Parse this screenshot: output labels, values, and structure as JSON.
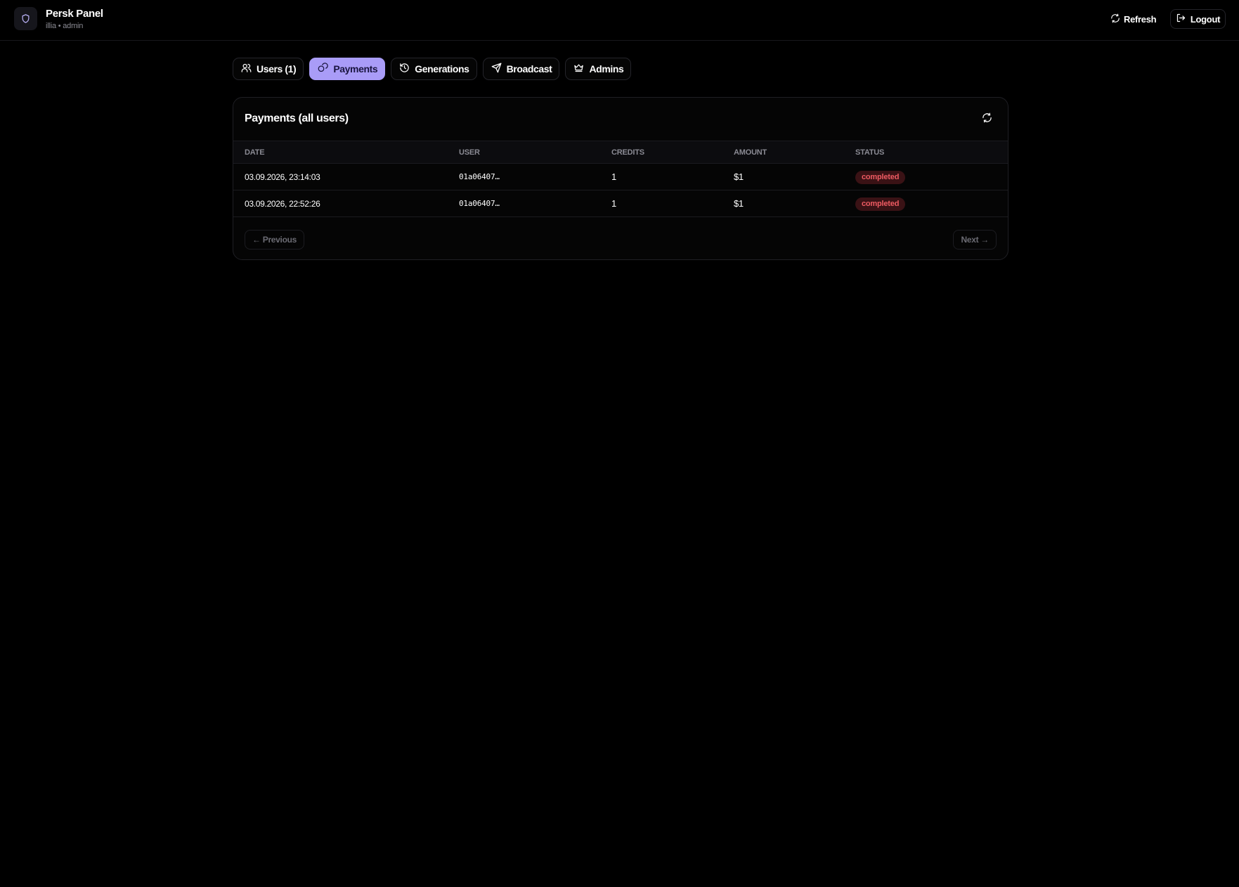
{
  "header": {
    "title": "Persk Panel",
    "subtitle": "illia • admin",
    "refresh_label": "Refresh",
    "logout_label": "Logout"
  },
  "tabs": [
    {
      "label": "Users (1)",
      "icon": "users-icon",
      "active": false
    },
    {
      "label": "Payments",
      "icon": "coins-icon",
      "active": true
    },
    {
      "label": "Generations",
      "icon": "history-icon",
      "active": false
    },
    {
      "label": "Broadcast",
      "icon": "send-icon",
      "active": false
    },
    {
      "label": "Admins",
      "icon": "crown-icon",
      "active": false
    }
  ],
  "payments": {
    "title": "Payments (all users)",
    "columns": [
      "DATE",
      "USER",
      "CREDITS",
      "AMOUNT",
      "STATUS"
    ],
    "rows": [
      {
        "date": "03.09.2026, 23:14:03",
        "user": "01a06407…",
        "credits": "1",
        "amount": "$1",
        "status": "completed"
      },
      {
        "date": "03.09.2026, 22:52:26",
        "user": "01a06407…",
        "credits": "1",
        "amount": "$1",
        "status": "completed"
      }
    ],
    "prev_label": "← Previous",
    "next_label": "Next →"
  },
  "colors": {
    "accent": "#a99cf7",
    "background": "#000000",
    "status_completed": "#ef5b62"
  }
}
